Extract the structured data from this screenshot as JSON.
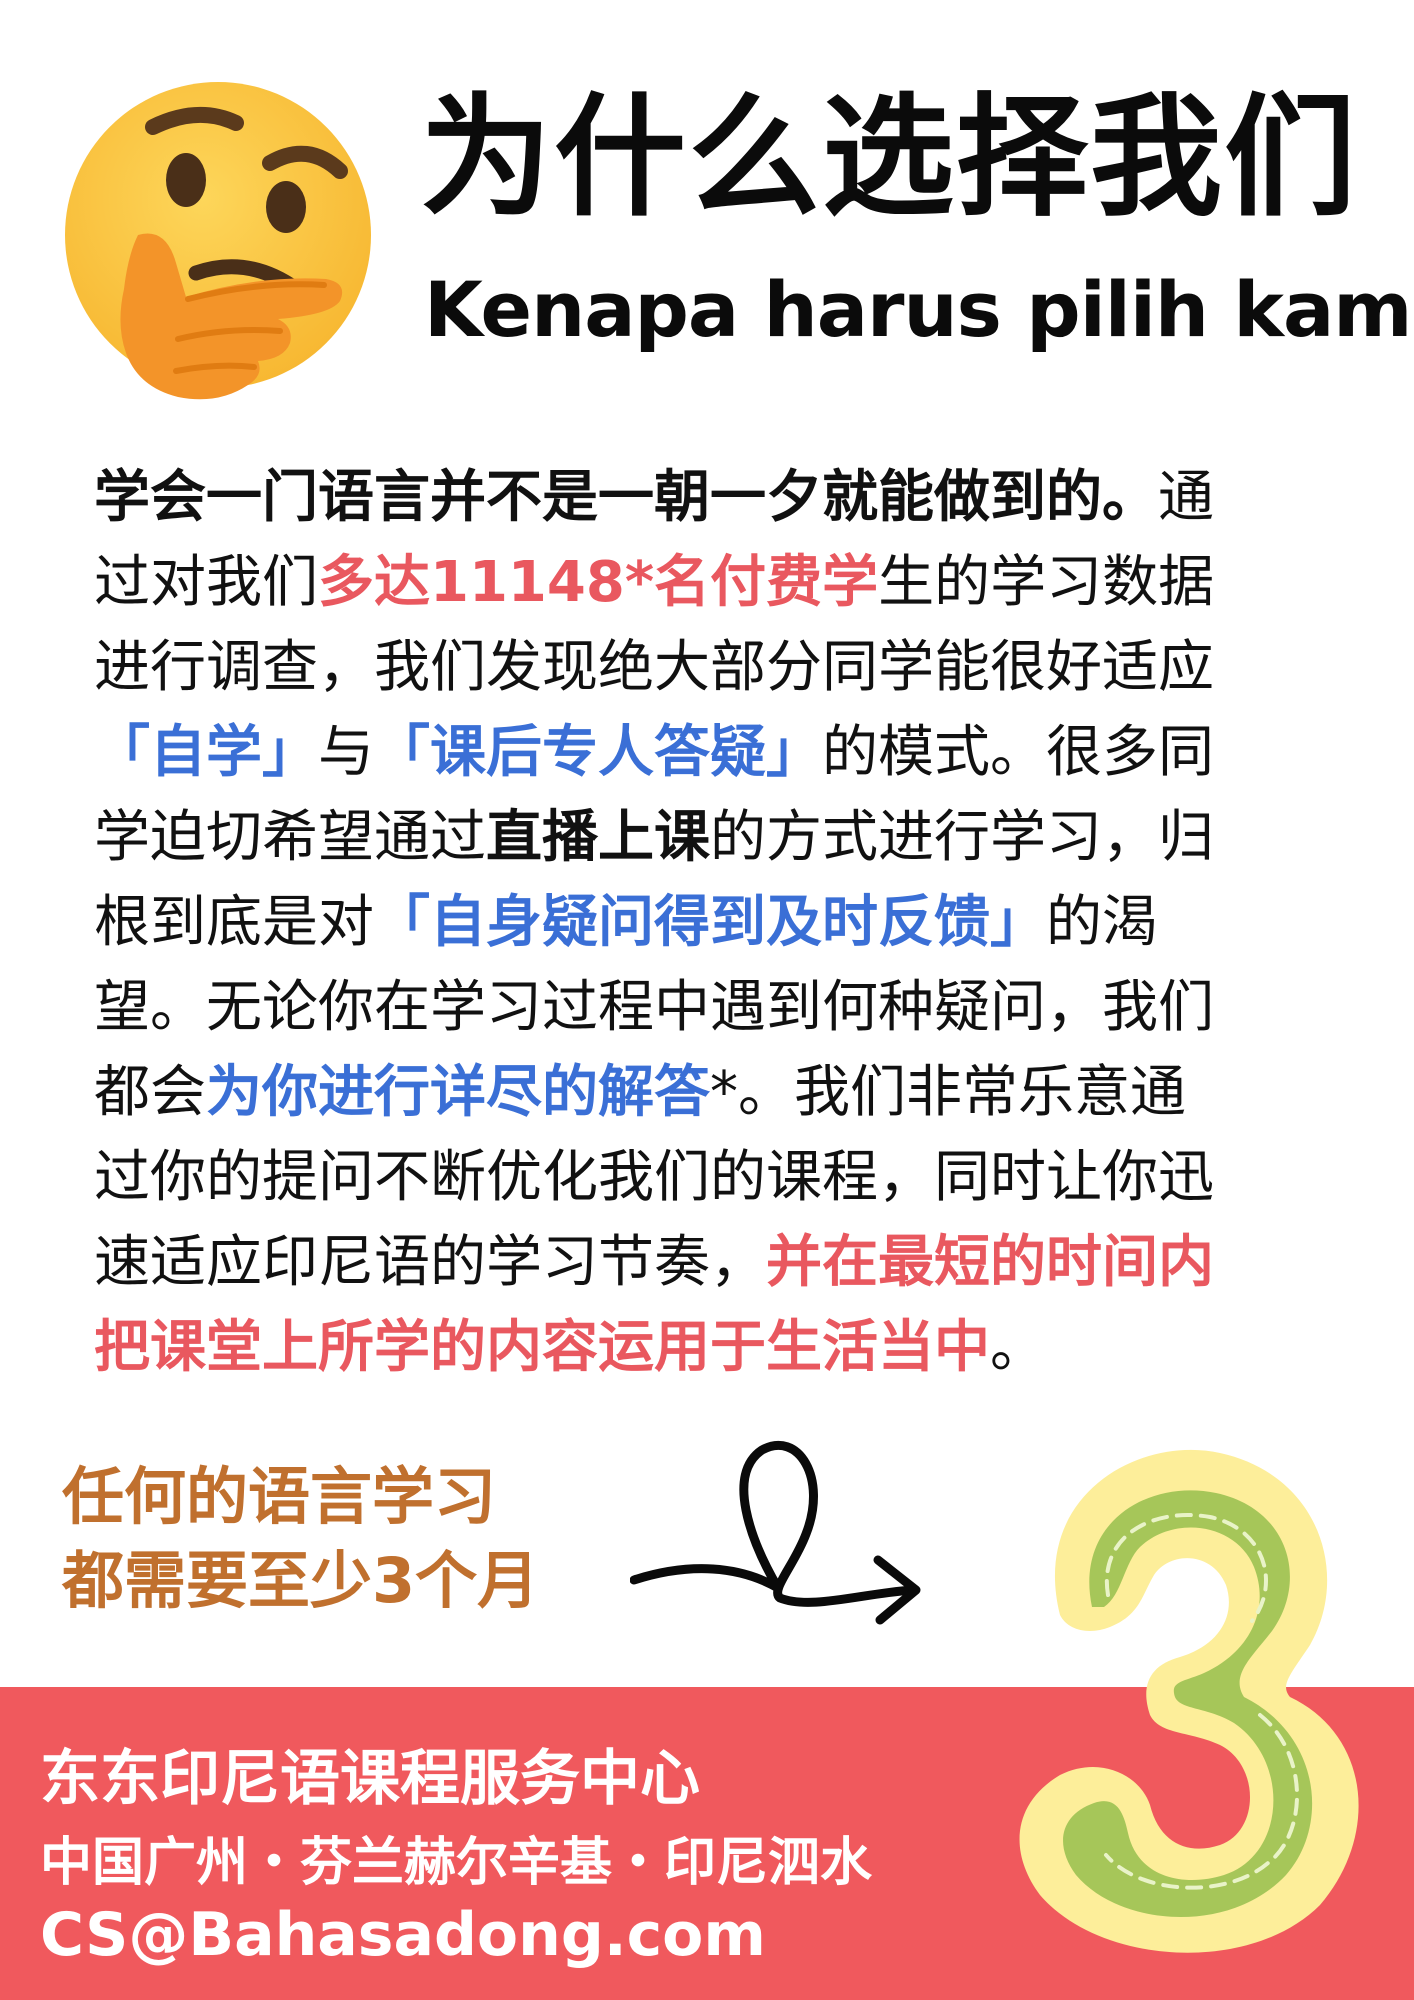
{
  "header": {
    "title_cn": "为什么选择我们",
    "title_id": "Kenapa harus pilih kami"
  },
  "body": {
    "l1_a": "学会一门语言并不是一朝一夕就能做到的。",
    "l1_b": "通",
    "l2_a": "过对我们",
    "l2_b": "多达11148*名付费学",
    "l2_c": "生的学习数据",
    "l3": "进行调查，我们发现绝大部分同学能很好适应",
    "l4_a": "「自学」",
    "l4_b": "与",
    "l4_c": "「课后专人答疑」",
    "l4_d": "的模式。很多同",
    "l5_a": "学迫切希望通过",
    "l5_b": "直播上课",
    "l5_c": "的方式进行学习，归",
    "l6_a": "根到底是对",
    "l6_b": "「自身疑问得到及时反馈」",
    "l6_c": "的渴",
    "l7": "望。无论你在学习过程中遇到何种疑问，我们",
    "l8_a": "都会",
    "l8_b": "为你进行详尽的解答",
    "l8_c": "*。我们非常乐意通",
    "l9": "过你的提问不断优化我们的课程，同时让你迅",
    "l10_a": "速适应印尼语的学习节奏，",
    "l10_b": "并在最短的时间内",
    "l11_a": "把课堂上所学的内容运用于生活当中",
    "l11_b": "。"
  },
  "note": {
    "line1": "任何的语言学习",
    "line2": "都需要至少3个月"
  },
  "footer": {
    "name": "东东印尼语课程服务中心",
    "locations": "中国广州・芬兰赫尔辛基・印尼泗水",
    "email": "CS@Bahasadong.com"
  },
  "colors": {
    "accent_red": "#e9585f",
    "accent_blue": "#3a6fd6",
    "note_brown": "#c0702e",
    "footer_bg": "#f0595d"
  },
  "icons": {
    "emoji": "thinking-face-icon",
    "arrow": "looped-arrow-icon",
    "number": "felt-number-3-icon"
  }
}
